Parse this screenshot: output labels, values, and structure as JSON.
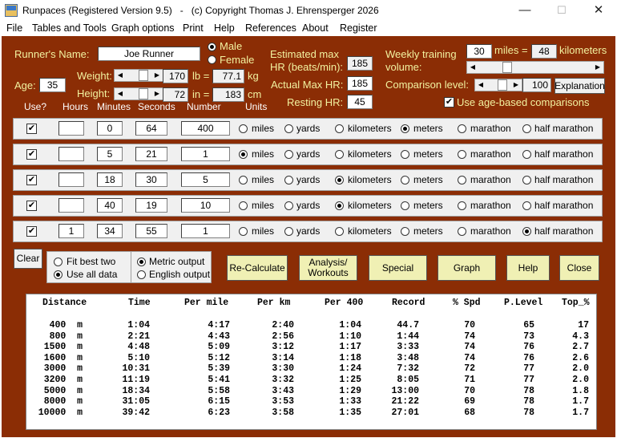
{
  "window": {
    "title": "Runpaces (Registered Version 9.5)   -   (c) Copyright Thomas J. Ehrensperger 2026",
    "minimize": "—",
    "maximize": "☐",
    "close": "✕"
  },
  "menu": [
    "File",
    "Tables and Tools",
    "Graph options",
    "Print",
    "Help",
    "References",
    "About",
    "Register"
  ],
  "runner": {
    "name_label": "Runner's Name:",
    "name": "Joe Runner",
    "male": "Male",
    "female": "Female",
    "sex_selected": "male",
    "age_label": "Age:",
    "age": "35",
    "weight_label": "Weight:",
    "weight_lb": "170",
    "lb_eq": "lb =",
    "weight_kg": "77.1",
    "kg": "kg",
    "height_label": "Height:",
    "height_in": "72",
    "in_eq": "in =",
    "height_cm": "183",
    "cm": "cm",
    "est_max_hr_label_1": "Estimated max",
    "est_max_hr_label_2": "HR (beats/min):",
    "est_max_hr": "185",
    "actual_max_hr_label": "Actual Max HR:",
    "actual_max_hr": "185",
    "resting_hr_label": "Resting HR:",
    "resting_hr": "45",
    "weekly_label_1": "Weekly training",
    "weekly_label_2": "volume:",
    "weekly_miles": "30",
    "miles_eq": "miles =",
    "weekly_km": "48",
    "kilometers": "kilometers",
    "comparison_label": "Comparison level:",
    "comparison": "100",
    "explanation": "Explanation",
    "age_based_label": "Use age-based comparisons",
    "age_based": true
  },
  "columns": {
    "use": "Use?",
    "hours": "Hours",
    "minutes": "Minutes",
    "seconds": "Seconds",
    "number": "Number",
    "units": "Units"
  },
  "unit_options": [
    "miles",
    "yards",
    "kilometers",
    "meters",
    "marathon",
    "half marathon"
  ],
  "races": [
    {
      "use": true,
      "hours": "",
      "minutes": "0",
      "seconds": "64",
      "number": "400",
      "unit": 3
    },
    {
      "use": true,
      "hours": "",
      "minutes": "5",
      "seconds": "21",
      "number": "1",
      "unit": 0
    },
    {
      "use": true,
      "hours": "",
      "minutes": "18",
      "seconds": "30",
      "number": "5",
      "unit": 2
    },
    {
      "use": true,
      "hours": "",
      "minutes": "40",
      "seconds": "19",
      "number": "10",
      "unit": 2
    },
    {
      "use": true,
      "hours": "1",
      "minutes": "34",
      "seconds": "55",
      "number": "1",
      "unit": 5
    }
  ],
  "controls": {
    "clear": "Clear",
    "fit_best_two": "Fit best two",
    "use_all_data": "Use all data",
    "fit_selected": "all",
    "metric_output": "Metric output",
    "english_output": "English output",
    "output_selected": "metric",
    "recalculate": "Re-Calculate",
    "analysis_1": "Analysis/",
    "analysis_2": "Workouts",
    "special": "Special",
    "graph": "Graph",
    "help": "Help",
    "close": "Close"
  },
  "results": {
    "headers": [
      "Distance",
      "Time",
      "Per mile",
      "Per km",
      "Per 400",
      "Record",
      "% Spd",
      "P.Level",
      "Top_%"
    ],
    "rows": [
      [
        "400  m",
        "1:04",
        "4:17",
        "2:40",
        "1:04",
        "44.7",
        "70",
        "65",
        "17"
      ],
      [
        "800  m",
        "2:21",
        "4:43",
        "2:56",
        "1:10",
        "1:44",
        "74",
        "73",
        "4.3"
      ],
      [
        "1500  m",
        "4:48",
        "5:09",
        "3:12",
        "1:17",
        "3:33",
        "74",
        "76",
        "2.7"
      ],
      [
        "1600  m",
        "5:10",
        "5:12",
        "3:14",
        "1:18",
        "3:48",
        "74",
        "76",
        "2.6"
      ],
      [
        "3000  m",
        "10:31",
        "5:39",
        "3:30",
        "1:24",
        "7:32",
        "72",
        "77",
        "2.0"
      ],
      [
        "3200  m",
        "11:19",
        "5:41",
        "3:32",
        "1:25",
        "8:05",
        "71",
        "77",
        "2.0"
      ],
      [
        "5000  m",
        "18:34",
        "5:58",
        "3:43",
        "1:29",
        "13:00",
        "70",
        "78",
        "1.8"
      ],
      [
        "8000  m",
        "31:05",
        "6:15",
        "3:53",
        "1:33",
        "21:22",
        "69",
        "78",
        "1.7"
      ],
      [
        "10000  m",
        "39:42",
        "6:23",
        "3:58",
        "1:35",
        "27:01",
        "68",
        "78",
        "1.7"
      ]
    ]
  }
}
